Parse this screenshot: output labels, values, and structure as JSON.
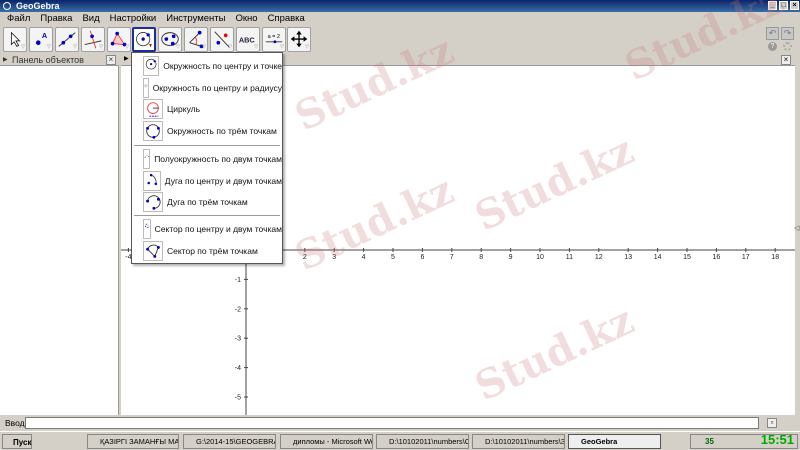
{
  "window": {
    "title": "GeoGebra"
  },
  "menubar": [
    "Файл",
    "Правка",
    "Вид",
    "Настройки",
    "Инструменты",
    "Окно",
    "Справка"
  ],
  "toolbar": [
    "move",
    "point",
    "line",
    "perpendicular",
    "polygon",
    "circle",
    "conic",
    "angle",
    "reflect",
    "text",
    "slider",
    "move-view"
  ],
  "toolbar_text": {
    "text_tool": "ABC",
    "slider_tool": "a = 2"
  },
  "left_panel": {
    "title": "Панель объектов"
  },
  "dropdown": {
    "groups": [
      [
        "Окружность по центру и точке",
        "Окружность по центру и радиусу",
        "Циркуль",
        "Окружность по трём точкам"
      ],
      [
        "Полуокружность по двум точкам",
        "Дуга по центру и двум точкам",
        "Дуга по трём точкам"
      ],
      [
        "Сектор по центру и двум точкам",
        "Сектор по трём точкам"
      ]
    ]
  },
  "axes": {
    "x_ticks": [
      -4,
      2,
      3,
      4,
      5,
      6,
      7,
      8,
      9,
      10,
      11,
      12,
      13,
      14,
      15,
      16,
      17,
      18
    ],
    "y_ticks": [
      -1,
      -2,
      -3,
      -4,
      -5
    ]
  },
  "input": {
    "label": "Ввод:",
    "value": ""
  },
  "taskbar": {
    "start": "Пуск",
    "items": [
      "ҚАЗІРГІ ЗАМАНҒЫ МАТ...",
      "G:\\2014-15\\GEOGEBRA",
      "дипломы - Microsoft Wo...",
      "D:\\10102011\\numbers\\C...",
      "D:\\10102011\\numbers\\З...",
      "GeoGebra"
    ],
    "tray_num": "35",
    "clock": "15:51"
  },
  "watermark": "Stud.kz"
}
